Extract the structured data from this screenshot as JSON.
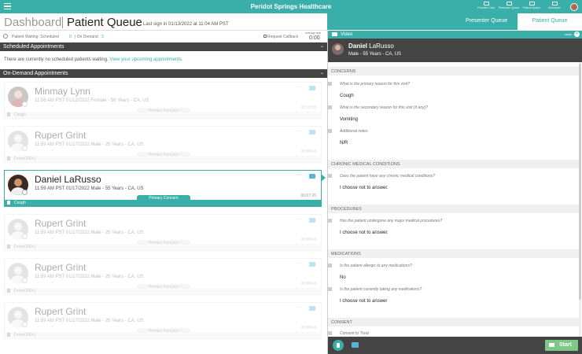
{
  "topbar": {
    "title": "Peridot Springs Healthcare",
    "actions": [
      {
        "label": "Provider Chat",
        "icon": "chat-icon"
      },
      {
        "label": "Presenter Queue",
        "icon": "presenter-queue-icon"
      },
      {
        "label": "Patient Queue",
        "icon": "patient-queue-icon"
      },
      {
        "label": "Scheduler",
        "icon": "calendar-icon"
      }
    ]
  },
  "header": {
    "dashboard": "Dashboard",
    "page_title": "Patient Queue",
    "signin": "Last sign in 01/13/2022 at 11:04 AM PST"
  },
  "tabs": {
    "presenter": "Presenter Queue",
    "patient": "Patient Queue"
  },
  "status": {
    "waiting_label": "Patient Waiting:",
    "scheduled_label": "Scheduled",
    "scheduled_count": "0",
    "ondemand_label": "| On Demand",
    "ondemand_count": "3",
    "callback": "Request Callback",
    "avg_label": "average wait",
    "avg_time": "0:00"
  },
  "scheduled": {
    "title": "Scheduled Appointments",
    "empty": "There are currently no scheduled patients waiting.",
    "link": "View your upcoming appointments."
  },
  "ondemand": {
    "title": "On-Demand Appointments"
  },
  "cards": [
    {
      "name": "Minmay Lynn",
      "meta": "11:56 AM PST 01/12/2022 Female - 56 Years - CA, US",
      "time": "00:10:53",
      "concern_label": "Primary Concern",
      "concern": "Cough"
    },
    {
      "name": "Rupert Grint",
      "meta": "11:59 AM PST 01/17/2022 Male - 26 Years - CA, US",
      "time": "00:08:04",
      "concern_label": "Primary Concern",
      "concern": "Fever(100+)"
    },
    {
      "name": "Daniel LaRusso",
      "meta": "11:59 AM PST 01/17/2022 Male - 55 Years - CA, US",
      "time": "00:07:26",
      "concern_label": "Primary Concern",
      "concern": "Cough"
    },
    {
      "name": "Rupert Grint",
      "meta": "11:59 AM PST 01/17/2022 Male - 26 Years - CA, US",
      "time": "00:08:04",
      "concern_label": "Primary Concern",
      "concern": "Fever(100+)"
    },
    {
      "name": "Rupert Grint",
      "meta": "11:59 AM PST 01/17/2022 Male - 26 Years - CA, US",
      "time": "00:08:04",
      "concern_label": "Primary Concern",
      "concern": "Fever(100+)"
    },
    {
      "name": "Rupert Grint",
      "meta": "11:59 AM PST 01/17/2022 Male - 26 Years - CA, US",
      "time": "00:08:04",
      "concern_label": "Primary Concern",
      "concern": "Fever(100+)"
    }
  ],
  "video": {
    "title": "Video",
    "close": "close",
    "patient_first": "Daniel",
    "patient_last": "LaRusso",
    "patient_meta": "Male - 55 Years - CA, US",
    "start": "Start"
  },
  "intake": {
    "concerns_title": "CONCERNS",
    "q1": "What is the primary reason for this visit?",
    "a1": "Cough",
    "q2": "What is the secondary reason for this visit (if any)?",
    "a2": "Vomiting",
    "q3": "Additional notes",
    "a3": "N/R",
    "chronic_title": "CHRONIC MEDICAL CONDITIONS",
    "q4": "Does the patient have any chronic medical conditions?",
    "a4": "I choose not to answer.",
    "procedures_title": "PROCEDURES",
    "q5": "Has the patient undergone any major medical procedures?",
    "a5": "I choose not to answer.",
    "medications_title": "MEDICATIONS",
    "q6": "Is the patient allergic to any medications?",
    "a6": "No",
    "q7": "Is the patient currently taking any medications?",
    "a7": "I choose not to answer",
    "consent_title": "CONSENT",
    "q8": "Consent to Treat"
  },
  "colors": {
    "accent": "#3aafa9",
    "dark": "#444444",
    "start": "#7ec887",
    "chat": "#5ab6d6"
  }
}
